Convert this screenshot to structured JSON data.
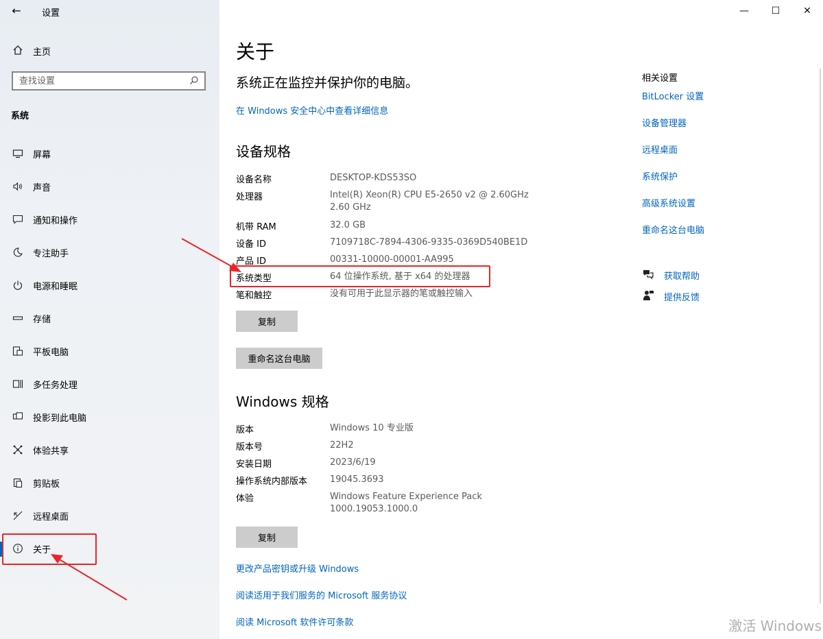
{
  "window": {
    "title": "设置",
    "back_glyph": "←",
    "minimize_glyph": "—",
    "maximize_glyph": "☐",
    "close_glyph": "✕"
  },
  "sidebar": {
    "home_label": "主页",
    "search_placeholder": "查找设置",
    "section_label": "系统",
    "items": [
      {
        "label": "屏幕",
        "icon": "monitor-icon"
      },
      {
        "label": "声音",
        "icon": "speaker-icon"
      },
      {
        "label": "通知和操作",
        "icon": "message-icon"
      },
      {
        "label": "专注助手",
        "icon": "moon-icon"
      },
      {
        "label": "电源和睡眠",
        "icon": "power-icon"
      },
      {
        "label": "存储",
        "icon": "storage-icon"
      },
      {
        "label": "平板电脑",
        "icon": "tablet-icon"
      },
      {
        "label": "多任务处理",
        "icon": "multitask-icon"
      },
      {
        "label": "投影到此电脑",
        "icon": "project-icon"
      },
      {
        "label": "体验共享",
        "icon": "share-icon"
      },
      {
        "label": "剪贴板",
        "icon": "clipboard-icon"
      },
      {
        "label": "远程桌面",
        "icon": "remote-icon"
      },
      {
        "label": "关于",
        "icon": "info-icon",
        "active": true
      }
    ]
  },
  "main": {
    "title": "关于",
    "status": "系统正在监控并保护你的电脑。",
    "security_link": "在 Windows 安全中心中查看详细信息",
    "device_specs": {
      "heading": "设备规格",
      "rows": [
        {
          "key": "设备名称",
          "value": "DESKTOP-KDS53SO"
        },
        {
          "key": "处理器",
          "value": "Intel(R) Xeon(R) CPU E5-2650 v2 @ 2.60GHz   2.60 GHz"
        },
        {
          "key": "机带 RAM",
          "value": "32.0 GB"
        },
        {
          "key": "设备 ID",
          "value": "7109718C-7894-4306-9335-0369D540BE1D"
        },
        {
          "key": "产品 ID",
          "value": "00331-10000-00001-AA995"
        },
        {
          "key": "系统类型",
          "value": "64 位操作系统, 基于 x64 的处理器"
        },
        {
          "key": "笔和触控",
          "value": "没有可用于此显示器的笔或触控输入"
        }
      ],
      "copy_label": "复制",
      "rename_label": "重命名这台电脑"
    },
    "windows_specs": {
      "heading": "Windows 规格",
      "rows": [
        {
          "key": "版本",
          "value": "Windows 10 专业版"
        },
        {
          "key": "版本号",
          "value": "22H2"
        },
        {
          "key": "安装日期",
          "value": "2023/6/19"
        },
        {
          "key": "操作系统内部版本",
          "value": "19045.3693"
        },
        {
          "key": "体验",
          "value": "Windows Feature Experience Pack 1000.19053.1000.0"
        }
      ],
      "copy_label": "复制"
    },
    "bottom_links": [
      "更改产品密钥或升级 Windows",
      "阅读适用于我们服务的 Microsoft 服务协议",
      "阅读 Microsoft 软件许可条款"
    ]
  },
  "related": {
    "title": "相关设置",
    "links": [
      "BitLocker 设置",
      "设备管理器",
      "远程桌面",
      "系统保护",
      "高级系统设置",
      "重命名这台电脑"
    ],
    "help_label": "获取帮助",
    "feedback_label": "提供反馈"
  },
  "watermark": "激活 Windows",
  "colors": {
    "link": "#0064bf",
    "highlight": "#e8262a",
    "accent": "#0067c0"
  }
}
